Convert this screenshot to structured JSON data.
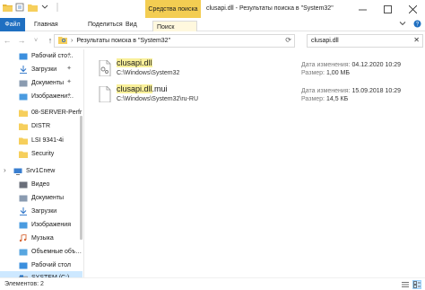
{
  "window": {
    "title": "clusapi.dll - Результаты поиска в \"System32\"",
    "context_tab": "Средства поиска"
  },
  "ribbon": {
    "tabs": [
      "Файл",
      "Главная",
      "Поделиться",
      "Вид",
      "Поиск"
    ]
  },
  "address": {
    "path": "Результаты поиска в \"System32\""
  },
  "search": {
    "query": "clusapi.dll"
  },
  "sidebar": {
    "items": [
      {
        "label": "Рабочий сто…",
        "icon": "desktop-blue-icon",
        "pinned": true
      },
      {
        "label": "Загрузки",
        "icon": "download-icon",
        "pinned": true
      },
      {
        "label": "Документы",
        "icon": "documents-icon",
        "pinned": true
      },
      {
        "label": "Изображени…",
        "icon": "pictures-icon",
        "pinned": true
      },
      {
        "label": "08-SERVER-Perfr",
        "icon": "folder-yellow-icon",
        "pinned": false
      },
      {
        "label": "DISTR",
        "icon": "folder-yellow-icon",
        "pinned": false
      },
      {
        "label": "LSI 9341-4i",
        "icon": "folder-yellow-icon",
        "pinned": false
      },
      {
        "label": "Security",
        "icon": "folder-yellow-icon",
        "pinned": false
      },
      {
        "label": "Srv1Cnew",
        "icon": "computer-icon",
        "pinned": false
      },
      {
        "label": "Видео",
        "icon": "video-icon",
        "pinned": false
      },
      {
        "label": "Документы",
        "icon": "documents-icon",
        "pinned": false
      },
      {
        "label": "Загрузки",
        "icon": "download-icon",
        "pinned": false
      },
      {
        "label": "Изображения",
        "icon": "pictures-icon",
        "pinned": false
      },
      {
        "label": "Музыка",
        "icon": "music-icon",
        "pinned": false
      },
      {
        "label": "Объемные объ…",
        "icon": "3d-objects-icon",
        "pinned": false
      },
      {
        "label": "Рабочий стол",
        "icon": "desktop-blue-icon",
        "pinned": false
      },
      {
        "label": "SYSTEM (C:)",
        "icon": "drive-icon",
        "pinned": false
      }
    ]
  },
  "results": [
    {
      "name_highlight": "clusapi.dll",
      "name_rest": "",
      "path": "C:\\Windows\\System32",
      "date_label": "Дата изменения:",
      "date_value": "04.12.2020 10:29",
      "size_label": "Размер:",
      "size_value": "1,00 МБ"
    },
    {
      "name_highlight": "clusapi.dll",
      "name_rest": ".mui",
      "path": "C:\\Windows\\System32\\ru-RU",
      "date_label": "Дата изменения:",
      "date_value": "15.09.2018 10:29",
      "size_label": "Размер:",
      "size_value": "14,5 КБ"
    }
  ],
  "status": {
    "count_text": "Элементов: 2"
  },
  "colors": {
    "accent": "#1f6fc1",
    "context_tab": "#f3cd52",
    "highlight": "#f9f09a",
    "selection": "#cde8ff"
  }
}
